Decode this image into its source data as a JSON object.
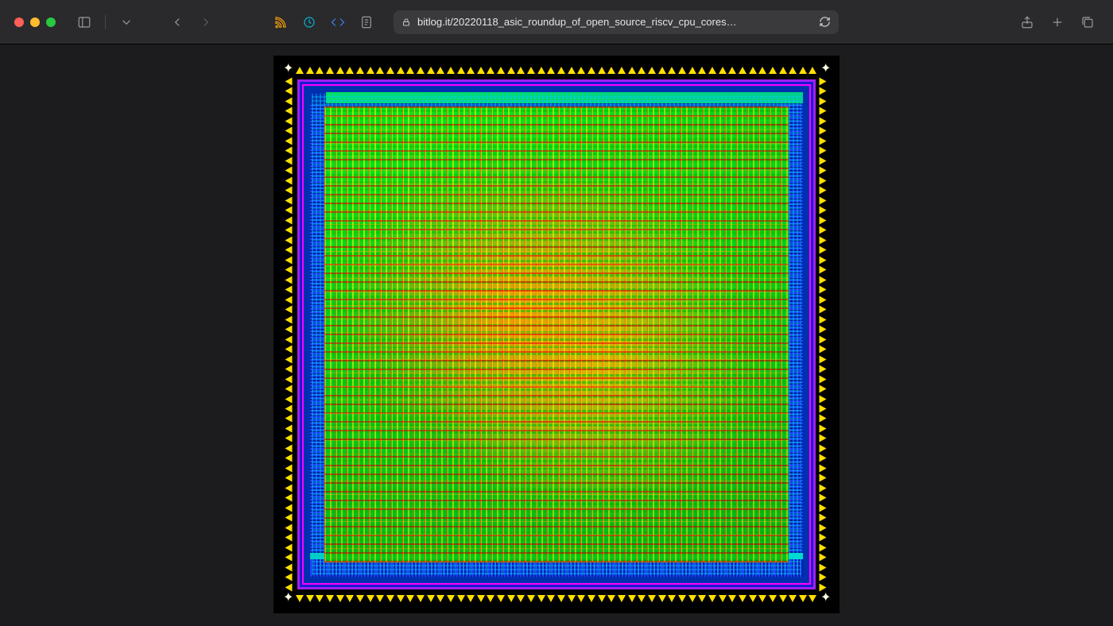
{
  "browser": {
    "url": "bitlog.it/20220118_asic_roundup_of_open_source_riscv_cpu_cores…",
    "secure": true
  },
  "content": {
    "image_description": "ASIC chip layout / place-and-route visualization (RISC-V CPU core)",
    "pad_count_per_side": 52
  }
}
